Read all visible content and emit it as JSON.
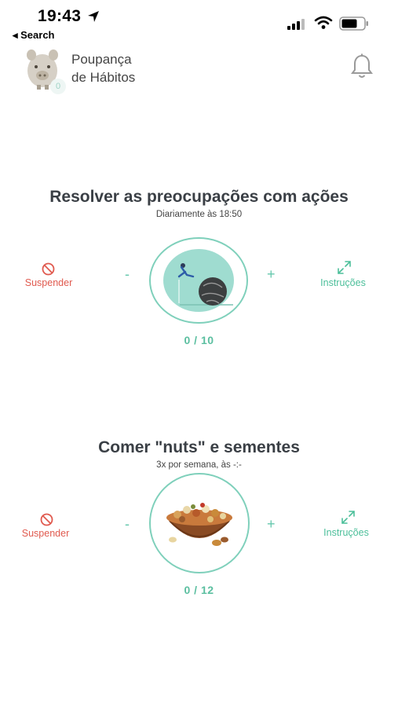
{
  "status_bar": {
    "time": "19:43",
    "back_label": "◂ Search"
  },
  "header": {
    "app_title_line1": "Poupança",
    "app_title_line2": "de Hábitos",
    "avatar_badge": "0"
  },
  "habits": [
    {
      "title": "Resolver as preocupações com ações",
      "schedule": "Diariamente às 18:50",
      "suspend_label": "Suspender",
      "instructions_label": "Instruções",
      "minus": "-",
      "plus": "+",
      "progress": "0 / 10"
    },
    {
      "title": "Comer \"nuts\" e sementes",
      "schedule": "3x por semana,  às -:-",
      "suspend_label": "Suspender",
      "instructions_label": "Instruções",
      "minus": "-",
      "plus": "+",
      "progress": "0 / 12"
    }
  ],
  "colors": {
    "accent": "#5bbfa0",
    "suspend": "#e05a4f",
    "ring": "#7fd0bb"
  }
}
